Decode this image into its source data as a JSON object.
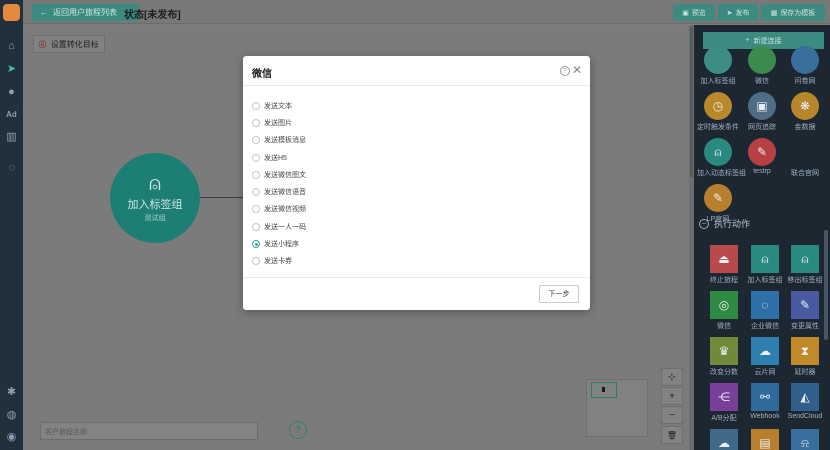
{
  "header": {
    "back_label": "返回用户旅程列表",
    "status_title": "状态[未发布]",
    "preview_label": "预览",
    "publish_label": "发布",
    "save_draft_label": "保存为模板"
  },
  "canvas": {
    "goal_label": "设置转化目标",
    "node": {
      "title": "加入标签组",
      "subtitle": "测试组"
    },
    "search_placeholder": "客户旅程名称",
    "help_glyph": "?",
    "zoom_buttons": [
      "⊹",
      "+",
      "−",
      "🗑"
    ]
  },
  "right_panel": {
    "new_conn_label": "新建连接",
    "trigger_tiles": [
      {
        "label": "加入标签组",
        "color": "#3d8d83",
        "icon": "tag-icon",
        "glyph": "",
        "round": true
      },
      {
        "label": "微信",
        "color": "#3c8a4c",
        "icon": "wechat-icon",
        "glyph": "",
        "round": true
      },
      {
        "label": "问卷网",
        "color": "#3a6e9b",
        "icon": "survey-icon",
        "glyph": "",
        "round": true
      },
      {
        "label": "定时触发条件",
        "color": "#b8882a",
        "icon": "clock-icon",
        "glyph": "◷",
        "round": true
      },
      {
        "label": "网页追踪",
        "color": "#4f6e86",
        "icon": "web-track-icon",
        "glyph": "▣",
        "round": true
      },
      {
        "label": "金数据",
        "color": "#b7852a",
        "icon": "jinshuju-icon",
        "glyph": "❋",
        "round": true
      },
      {
        "label": "加入动态标签组",
        "color": "#2a8a80",
        "icon": "dynamic-tag-icon",
        "glyph": "⍝",
        "round": true
      },
      {
        "label": "testrp",
        "color": "#b84045",
        "icon": "wrench-icon",
        "glyph": "✎",
        "round": true
      },
      {
        "label": "联合官网",
        "color": "#1c2731",
        "icon": "lp-logo-icon",
        "glyph": "",
        "round": false
      },
      {
        "label": "LP官网",
        "color": "#b8802e",
        "icon": "wrench-lp-icon",
        "glyph": "✎",
        "round": true
      }
    ],
    "action_section_title": "执行动作",
    "action_tiles": [
      {
        "label": "终止旅程",
        "color": "#b84a4c",
        "icon": "stop-icon",
        "glyph": "⏏"
      },
      {
        "label": "加入标签组",
        "color": "#2a8a80",
        "icon": "add-tag-icon",
        "glyph": "⍝"
      },
      {
        "label": "移出标签组",
        "color": "#2a8a80",
        "icon": "remove-tag-icon",
        "glyph": "⍝"
      },
      {
        "label": "微信",
        "color": "#2e8a42",
        "icon": "wechat-icon",
        "glyph": "◎"
      },
      {
        "label": "企业微信",
        "color": "#2e6fa8",
        "icon": "work-wechat-icon",
        "glyph": "◌"
      },
      {
        "label": "变更属性",
        "color": "#4a5aa0",
        "icon": "edit-attr-icon",
        "glyph": "✎"
      },
      {
        "label": "改变分数",
        "color": "#6f8a3a",
        "icon": "trophy-icon",
        "glyph": "♛"
      },
      {
        "label": "云片网",
        "color": "#2f7eb0",
        "icon": "cloud-icon",
        "glyph": "☁"
      },
      {
        "label": "延时器",
        "color": "#c08a2a",
        "icon": "hourglass-icon",
        "glyph": "⧗"
      },
      {
        "label": "A/B分配",
        "color": "#7a3f9a",
        "icon": "ab-split-icon",
        "glyph": "⋲"
      },
      {
        "label": "Webhook",
        "color": "#2f6a9a",
        "icon": "webhook-icon",
        "glyph": "⚯"
      },
      {
        "label": "SendCloud",
        "color": "#2f5f8a",
        "icon": "sendcloud-icon",
        "glyph": "◭"
      },
      {
        "label": "",
        "color": "#3f6a8a",
        "icon": "cloud-sync-icon",
        "glyph": "☁"
      },
      {
        "label": "",
        "color": "#b8802e",
        "icon": "window-icon",
        "glyph": "▤"
      },
      {
        "label": "",
        "color": "#3a6e9b",
        "icon": "bell-icon",
        "glyph": "⍾"
      }
    ]
  },
  "modal": {
    "title": "微信",
    "help_glyph": "?",
    "close_glyph": "✕",
    "options": [
      {
        "label": "发送文本",
        "checked": false
      },
      {
        "label": "发送图片",
        "checked": false
      },
      {
        "label": "发送模板消息",
        "checked": false
      },
      {
        "label": "发送H5",
        "checked": false
      },
      {
        "label": "发送微信图文",
        "checked": false
      },
      {
        "label": "发送微信语音",
        "checked": false
      },
      {
        "label": "发送微信视频",
        "checked": false
      },
      {
        "label": "发送一人一码",
        "checked": false
      },
      {
        "label": "发送小程序",
        "checked": true
      },
      {
        "label": "发送卡券",
        "checked": false
      }
    ],
    "next_label": "下一步"
  },
  "colors": {
    "accent": "#3aa89a",
    "nav_bg": "#22303c",
    "panel_bg": "#1c2731"
  }
}
